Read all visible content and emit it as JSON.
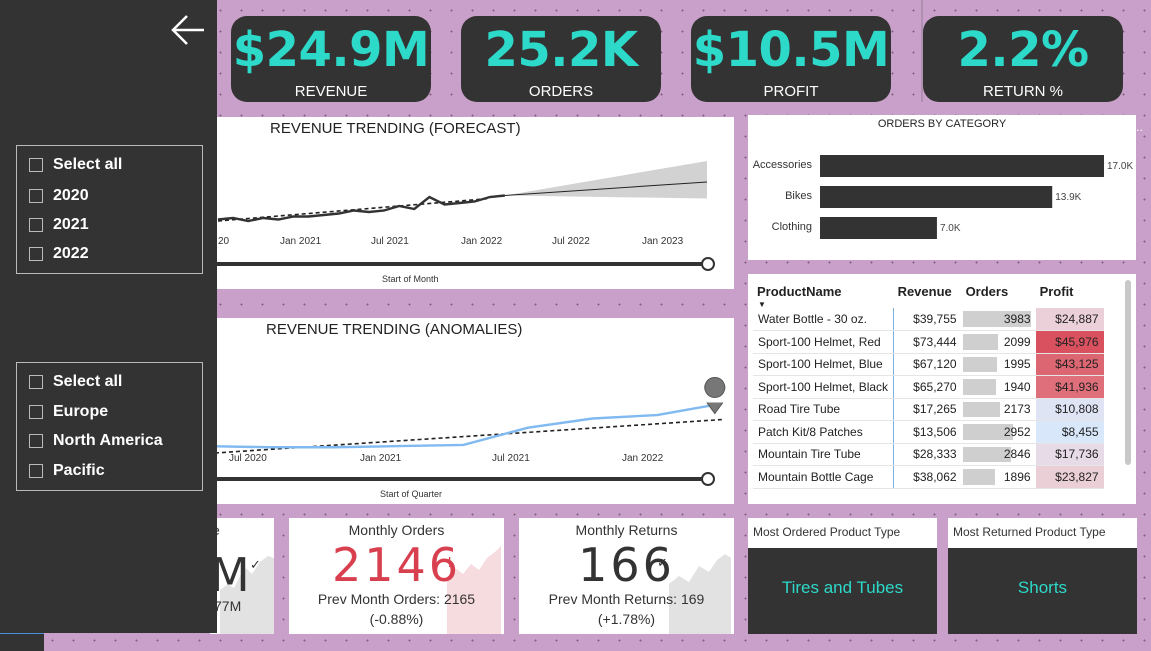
{
  "kpis": [
    {
      "value": "$24.9M",
      "label": "REVENUE"
    },
    {
      "value": "25.2K",
      "label": "ORDERS"
    },
    {
      "value": "$10.5M",
      "label": "PROFIT"
    },
    {
      "value": "2.2%",
      "label": "RETURN %"
    }
  ],
  "forecast_chart": {
    "title": "REVENUE TRENDING (FORECAST)",
    "xlabel": "Start of Month",
    "ticks": [
      "20",
      "Jan 2021",
      "Jul 2021",
      "Jan 2022",
      "Jul 2022",
      "Jan 2023"
    ]
  },
  "anomaly_chart": {
    "title": "REVENUE TRENDING (ANOMALIES)",
    "xlabel": "Start of Quarter",
    "ticks": [
      "Jul 2020",
      "Jan 2021",
      "Jul 2021",
      "Jan 2022"
    ]
  },
  "chart_data": [
    {
      "type": "line",
      "title": "REVENUE TRENDING (FORECAST)",
      "xlabel": "Start of Month",
      "ylabel": "",
      "x": [
        "2020-11",
        "2020-12",
        "2021-01",
        "2021-02",
        "2021-03",
        "2021-04",
        "2021-05",
        "2021-06",
        "2021-07",
        "2021-08",
        "2021-09",
        "2021-10",
        "2021-11",
        "2021-12",
        "2022-01",
        "2022-02",
        "2022-03",
        "2022-04",
        "2022-05",
        "2022-06"
      ],
      "series": [
        {
          "values": [
            0.5,
            0.6,
            0.4,
            0.6,
            0.5,
            0.7,
            0.7,
            0.8,
            0.9,
            1.1,
            1.0,
            1.1,
            1.4,
            1.2,
            2.0,
            1.5,
            1.6,
            1.7,
            2.0,
            2.1
          ]
        }
      ],
      "forecast": {
        "x_start": "2022-06",
        "x_end": "2023-06",
        "start": 2.1,
        "end": 3.0
      }
    },
    {
      "type": "line",
      "title": "REVENUE TRENDING (ANOMALIES)",
      "xlabel": "Start of Quarter",
      "ylabel": "",
      "x": [
        "2020-Q2",
        "2020-Q3",
        "2020-Q4",
        "2021-Q1",
        "2021-Q2",
        "2021-Q3",
        "2021-Q4",
        "2022-Q1",
        "2022-Q2"
      ],
      "series": [
        {
          "values": [
            0.6,
            0.5,
            0.5,
            0.6,
            0.7,
            2.2,
            3.0,
            3.3,
            4.3
          ]
        }
      ]
    },
    {
      "type": "bar",
      "title": "ORDERS BY CATEGORY",
      "categories": [
        "Accessories",
        "Bikes",
        "Clothing"
      ],
      "values": [
        17.0,
        13.9,
        7.0
      ],
      "labels": [
        "17.0K",
        "13.9K",
        "7.0K"
      ],
      "xlim": [
        0,
        17.0
      ]
    }
  ],
  "orders_by_category": {
    "title": "ORDERS BY CATEGORY"
  },
  "product_table": {
    "headers": [
      "ProductName",
      "Revenue",
      "Orders",
      "Profit"
    ],
    "rows": [
      {
        "name": "Water Bottle - 30 oz.",
        "revenue": "$39,755",
        "orders": "3983",
        "profit": "$24,887",
        "orders_n": 3983,
        "profit_color": "#ecd0d9"
      },
      {
        "name": "Sport-100 Helmet, Red",
        "revenue": "$73,444",
        "orders": "2099",
        "profit": "$45,976",
        "orders_n": 2099,
        "profit_color": "#d9515f"
      },
      {
        "name": "Sport-100 Helmet, Blue",
        "revenue": "$67,120",
        "orders": "1995",
        "profit": "$43,125",
        "orders_n": 1995,
        "profit_color": "#dc6672"
      },
      {
        "name": "Sport-100 Helmet, Black",
        "revenue": "$65,270",
        "orders": "1940",
        "profit": "$41,936",
        "orders_n": 1940,
        "profit_color": "#df6f7b"
      },
      {
        "name": "Road Tire Tube",
        "revenue": "$17,265",
        "orders": "2173",
        "profit": "$10,808",
        "orders_n": 2173,
        "profit_color": "#dfe4f4"
      },
      {
        "name": "Patch Kit/8 Patches",
        "revenue": "$13,506",
        "orders": "2952",
        "profit": "$8,455",
        "orders_n": 2952,
        "profit_color": "#d8e8fa"
      },
      {
        "name": "Mountain Tire Tube",
        "revenue": "$28,333",
        "orders": "2846",
        "profit": "$17,736",
        "orders_n": 2846,
        "profit_color": "#e6dbe6"
      },
      {
        "name": "Mountain Bottle Cage",
        "revenue": "$38,062",
        "orders": "1896",
        "profit": "$23,827",
        "orders_n": 1896,
        "profit_color": "#ebcfd6"
      }
    ]
  },
  "slicer_years": {
    "items": [
      "Select all",
      "2020",
      "2021",
      "2022"
    ]
  },
  "slicer_regions": {
    "items": [
      "Select all",
      "Europe",
      "North America",
      "Pacific"
    ]
  },
  "bottom_cards": {
    "revenue": {
      "title_fragment": "e",
      "value": "M",
      "sub": "77M"
    },
    "monthly_orders": {
      "title": "Monthly Orders",
      "value": "2146",
      "sub1": "Prev Month Orders: 2165",
      "sub2": "(-0.88%)",
      "status_glyph": "!"
    },
    "monthly_returns": {
      "title": "Monthly Returns",
      "value": "166",
      "sub1": "Prev Month Returns: 169",
      "sub2": "(+1.78%)",
      "status_glyph": "✓"
    },
    "most_ordered": {
      "title": "Most Ordered Product Type",
      "value": "Tires and Tubes"
    },
    "most_returned": {
      "title": "Most Returned Product Type",
      "value": "Shorts"
    }
  },
  "colors": {
    "accent": "#2dd9c8",
    "dark": "#333333",
    "background": "#c9a0c9",
    "trend_line": "#80baf0",
    "alert_red": "#d9404f"
  },
  "icons": {
    "back": "left-arrow-icon"
  }
}
